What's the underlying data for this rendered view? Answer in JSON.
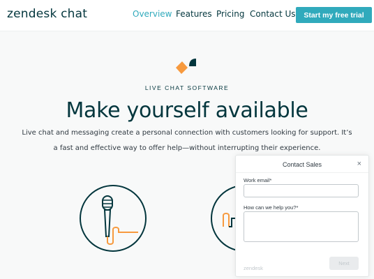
{
  "header": {
    "logo": "zendesk chat",
    "nav": [
      "Overview",
      "Features",
      "Pricing",
      "Contact Us"
    ],
    "cta": "Start my free trial"
  },
  "hero": {
    "eyebrow": "LIVE CHAT SOFTWARE",
    "headline": "Make yourself available",
    "body_line1": "Live chat and messaging create a personal connection with customers looking for support. It’s",
    "body_line2": "a fast and effective way to offer help—without interrupting their experience."
  },
  "contact_panel": {
    "title": "Contact Sales",
    "close": "×",
    "email_label": "Work email*",
    "help_label": "How can we help you?*",
    "footer_brand": "zendesk",
    "next_button": "Next"
  },
  "colors": {
    "brand_teal": "#30aabc",
    "brand_dark": "#03363d",
    "brand_orange": "#f79a3e",
    "page_bg": "#f8f9f9"
  },
  "icons": [
    "zendesk-brand-icon",
    "microphone-icon",
    "cable-icon",
    "close-icon"
  ]
}
